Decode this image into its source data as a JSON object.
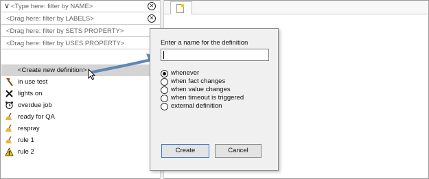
{
  "filters": [
    {
      "text": "<Type here: filter by NAME>",
      "icon": "chevron-down-icon"
    },
    {
      "text": "<Drag here: filter by LABELS>"
    },
    {
      "text": "<Drag here: filter by SETS PROPERTY>"
    },
    {
      "text": "<Drag here: filter by USES PROPERTY>"
    }
  ],
  "list": {
    "create_label": "<Create new definition>",
    "items": [
      {
        "label": "in use test",
        "icon": "hammer-icon"
      },
      {
        "label": "lights on",
        "icon": "tools-icon"
      },
      {
        "label": "overdue job",
        "icon": "alarm-clock-icon"
      },
      {
        "label": "ready for QA",
        "icon": "broom-icon"
      },
      {
        "label": "respray",
        "icon": "broom-icon"
      },
      {
        "label": "rule 1",
        "icon": "broom-icon"
      },
      {
        "label": "rule 2",
        "icon": "warning-icon"
      }
    ]
  },
  "dialog": {
    "title": "Enter a name for the definition",
    "name_value": "",
    "options": [
      {
        "label": "whenever",
        "selected": true
      },
      {
        "label": "when fact changes",
        "selected": false
      },
      {
        "label": "when value changes",
        "selected": false
      },
      {
        "label": "when timeout is triggered",
        "selected": false
      },
      {
        "label": "external definition",
        "selected": false
      }
    ],
    "create_label": "Create",
    "cancel_label": "Cancel"
  },
  "colors": {
    "accent": "#3a78c8",
    "arrow": "#5e87b5",
    "selection": "#d4d4d4"
  }
}
